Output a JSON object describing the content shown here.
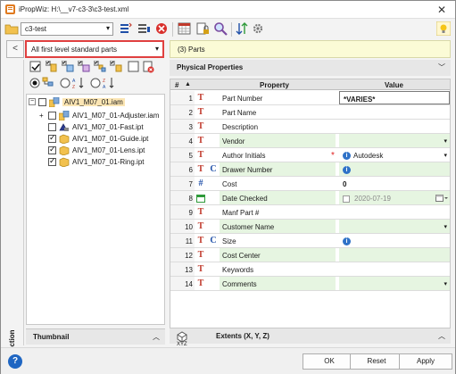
{
  "window": {
    "title": "iPropWiz: H:\\__v7-c3-3\\c3-test.xml"
  },
  "toolbar": {
    "config_combo_value": "c3-test"
  },
  "left": {
    "filter_value": "All first level standard parts",
    "sidebar_label": "Selection",
    "thumbnail_label": "Thumbnail",
    "tree": [
      {
        "label": "AIV1_M07_01.iam",
        "level": 0,
        "checked": false,
        "type": "assembly"
      },
      {
        "label": "AIV1_M07_01-Adjuster.iam",
        "level": 1,
        "checked": false,
        "type": "assembly"
      },
      {
        "label": "AIV1_M07_01-Fast.ipt",
        "level": 1,
        "checked": false,
        "type": "part-special"
      },
      {
        "label": "AIV1_M07_01-Guide.ipt",
        "level": 1,
        "checked": true,
        "type": "part"
      },
      {
        "label": "AIV1_M07_01-Lens.ipt",
        "level": 1,
        "checked": true,
        "type": "part"
      },
      {
        "label": "AIV1_M07_01-Ring.ipt",
        "level": 1,
        "checked": true,
        "type": "part"
      }
    ]
  },
  "right": {
    "parts_header": "(3) Parts",
    "section_title": "Physical Properties",
    "columns": {
      "num": "#",
      "property": "Property",
      "value": "Value"
    },
    "rows": [
      {
        "n": "1",
        "icon": "T",
        "name": "Part Number",
        "value": "*VARIES*",
        "kind": "varies",
        "alt": false
      },
      {
        "n": "2",
        "icon": "T",
        "name": "Part Name",
        "value": "",
        "kind": "plain",
        "alt": false
      },
      {
        "n": "3",
        "icon": "T",
        "name": "Description",
        "value": "",
        "kind": "plain",
        "alt": false
      },
      {
        "n": "4",
        "icon": "T",
        "name": "Vendor",
        "value": "",
        "kind": "dropdown",
        "alt": true
      },
      {
        "n": "5",
        "icon": "T",
        "name": "Author Initials",
        "value": "Autodesk",
        "kind": "info-dropdown",
        "alt": false,
        "required": "*"
      },
      {
        "n": "6",
        "icon": "T",
        "icon2": "C",
        "name": "Drawer Number",
        "value": "",
        "kind": "info",
        "alt": true
      },
      {
        "n": "7",
        "icon": "#",
        "name": "Cost",
        "value": "0",
        "kind": "bold",
        "alt": false
      },
      {
        "n": "8",
        "icon": "cal",
        "name": "Date Checked",
        "value": "2020-07-19",
        "kind": "date",
        "alt": true
      },
      {
        "n": "9",
        "icon": "T",
        "name": "Manf Part #",
        "value": "",
        "kind": "plain",
        "alt": false
      },
      {
        "n": "10",
        "icon": "T",
        "name": "Customer Name",
        "value": "",
        "kind": "dropdown",
        "alt": true
      },
      {
        "n": "11",
        "icon": "T",
        "icon2": "C",
        "name": "Size",
        "value": "",
        "kind": "info",
        "alt": false
      },
      {
        "n": "12",
        "icon": "T",
        "name": "Cost Center",
        "value": "",
        "kind": "plain",
        "alt": true
      },
      {
        "n": "13",
        "icon": "T",
        "name": "Keywords",
        "value": "",
        "kind": "plain",
        "alt": false
      },
      {
        "n": "14",
        "icon": "T",
        "name": "Comments",
        "value": "",
        "kind": "dropdown",
        "alt": true
      }
    ],
    "extents_label": "Extents (X, Y, Z)",
    "extents_icon_text": "XYZ"
  },
  "buttons": {
    "ok": "OK",
    "reset": "Reset",
    "apply": "Apply"
  },
  "colors": {
    "alt_row": "#e6f5e1",
    "parts_header_bg": "#fbfbd6",
    "filter_border": "#e04040",
    "icon_red": "#c0392b",
    "icon_blue": "#1f4fa8"
  }
}
